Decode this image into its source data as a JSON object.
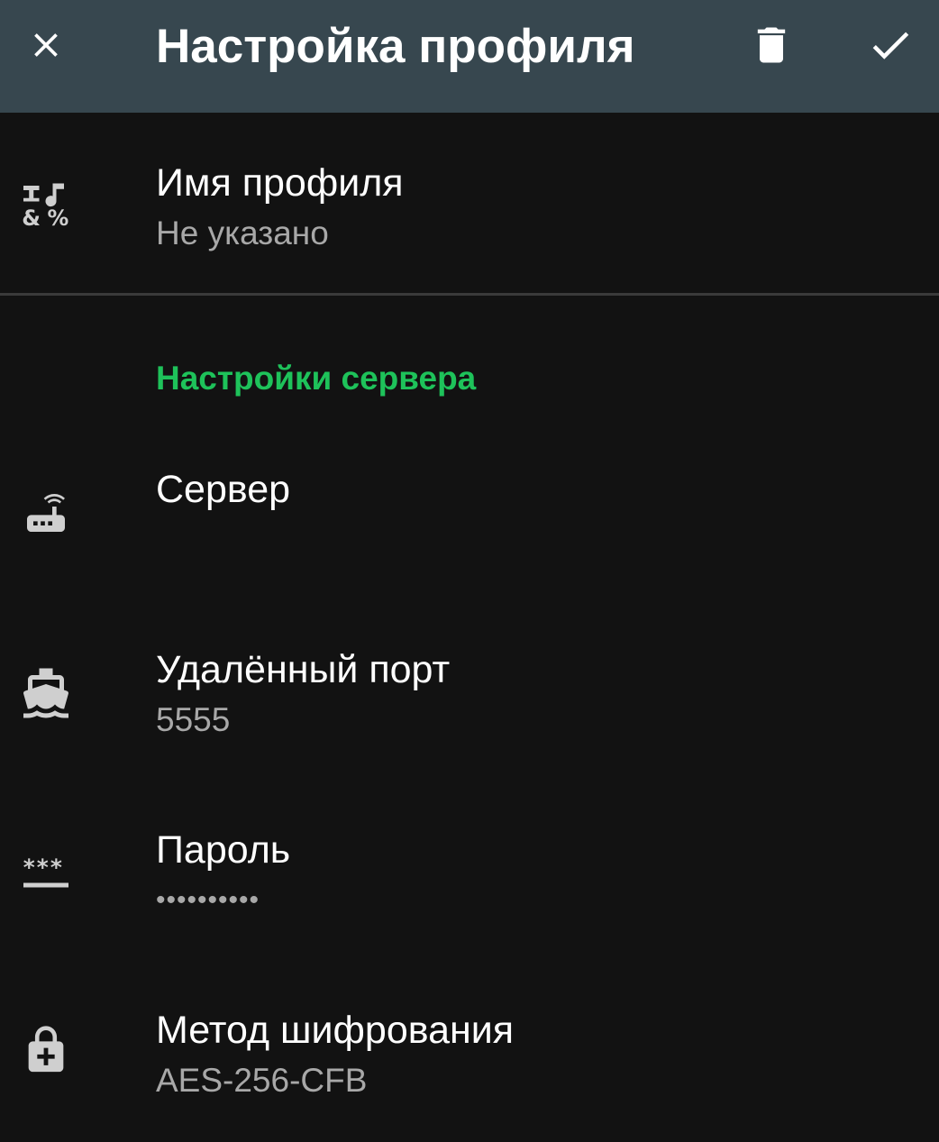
{
  "toolbar": {
    "title": "Настройка профиля",
    "close_icon": "close-icon",
    "delete_icon": "trash-icon",
    "save_icon": "check-icon"
  },
  "profile_name": {
    "title": "Имя профиля",
    "summary": "Не указано",
    "icon": "text-symbols-icon"
  },
  "server_section": {
    "header": "Настройки сервера",
    "server": {
      "title": "Сервер",
      "summary": "",
      "icon": "router-icon"
    },
    "remote_port": {
      "title": "Удалённый порт",
      "summary": "5555",
      "icon": "ferry-icon"
    },
    "password": {
      "title": "Пароль",
      "summary": "••••••••••",
      "icon": "password-icon"
    },
    "encryption": {
      "title": "Метод шифрования",
      "summary": "AES-256-CFB",
      "icon": "lock-plus-icon"
    }
  },
  "colors": {
    "toolbar": "#37474f",
    "background": "#121212",
    "accent": "#1ec25a",
    "summary": "#a8a8a8"
  }
}
